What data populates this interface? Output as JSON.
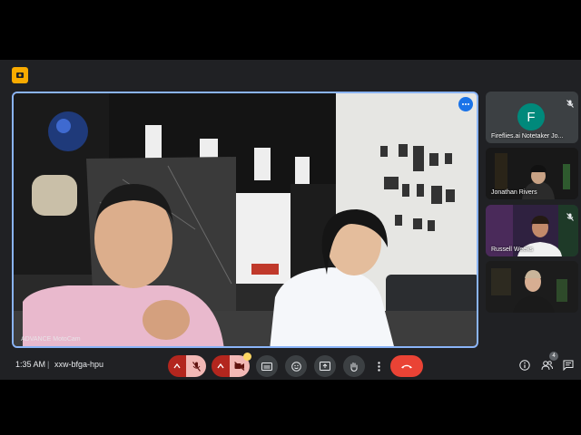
{
  "meeting": {
    "time": "1:35 AM",
    "separator": "|",
    "code": "xxw-bfga-hpu"
  },
  "main_tile": {
    "camera_label": "ADVANCE MotoCam"
  },
  "participants": [
    {
      "name": "Fireflies.ai Notetaker Jo...",
      "avatar_letter": "F",
      "avatar_color": "#00897b",
      "muted": true
    },
    {
      "name": "Jonathan Rivers",
      "muted": false
    },
    {
      "name": "Russell Weeks",
      "muted": true
    },
    {
      "name": "",
      "muted": false
    }
  ],
  "participant_count": "4",
  "colors": {
    "accent": "#8ab4f8",
    "hangup": "#ea4335",
    "muted_bg": "#f2b8b5",
    "panel": "#202124"
  },
  "icons": [
    "recording-badge-icon",
    "more-options-icon",
    "mic-off-icon",
    "camera-off-icon",
    "captions-icon",
    "emoji-icon",
    "present-icon",
    "raise-hand-icon",
    "more-vert-icon",
    "hang-up-icon",
    "info-icon",
    "people-icon",
    "chat-icon"
  ]
}
